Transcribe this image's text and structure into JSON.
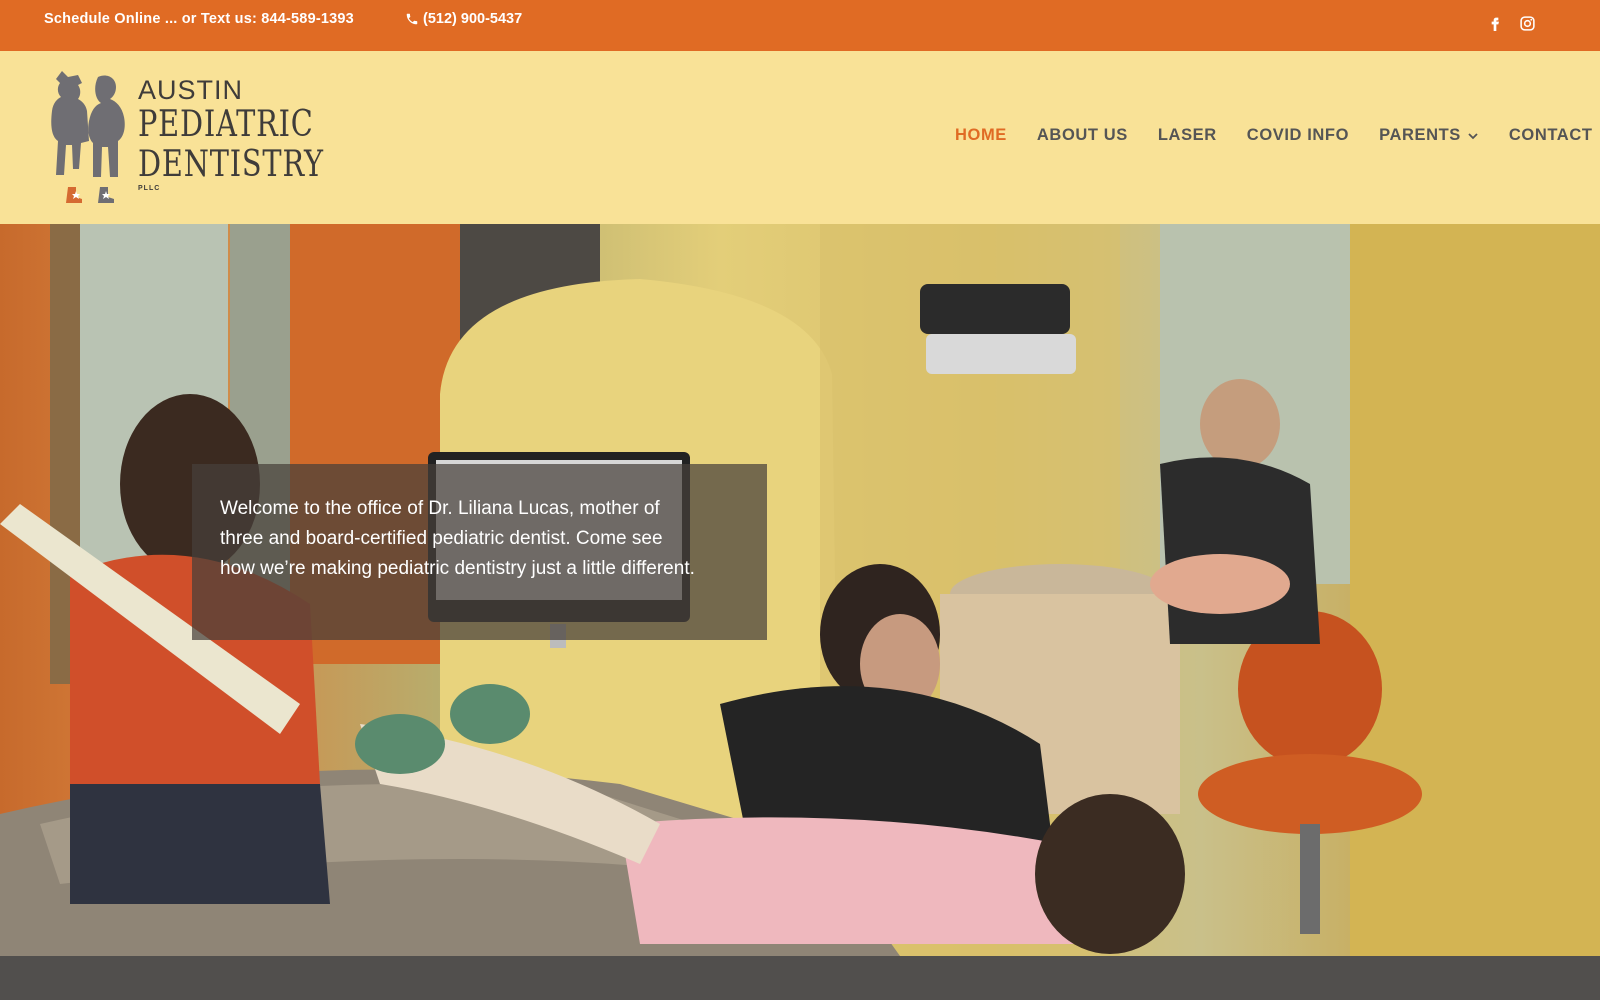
{
  "topbar": {
    "schedule_text": "Schedule Online ... or Text us: 844-589-1393",
    "phone_text": "(512) 900-5437",
    "social": [
      "facebook-icon",
      "instagram-icon"
    ]
  },
  "logo": {
    "line1": "AUSTIN",
    "line2": "PEDIATRIC",
    "line3": "DENTISTRY",
    "line4": "PLLC"
  },
  "nav": {
    "items": [
      {
        "label": "HOME",
        "active": true
      },
      {
        "label": "ABOUT US"
      },
      {
        "label": "LASER"
      },
      {
        "label": "COVID INFO"
      },
      {
        "label": "PARENTS",
        "has_dropdown": true
      },
      {
        "label": "CONTACT"
      }
    ]
  },
  "hero": {
    "welcome_text": "Welcome to the office of Dr. Liliana Lucas, mother of three and board-certified pediatric dentist. Come see how we’re making pediatric dentistry just a little different."
  },
  "colors": {
    "accent": "#e06b24",
    "header_bg": "#f9e297",
    "nav_text": "#555555",
    "footer_strip": "#514f4d"
  }
}
